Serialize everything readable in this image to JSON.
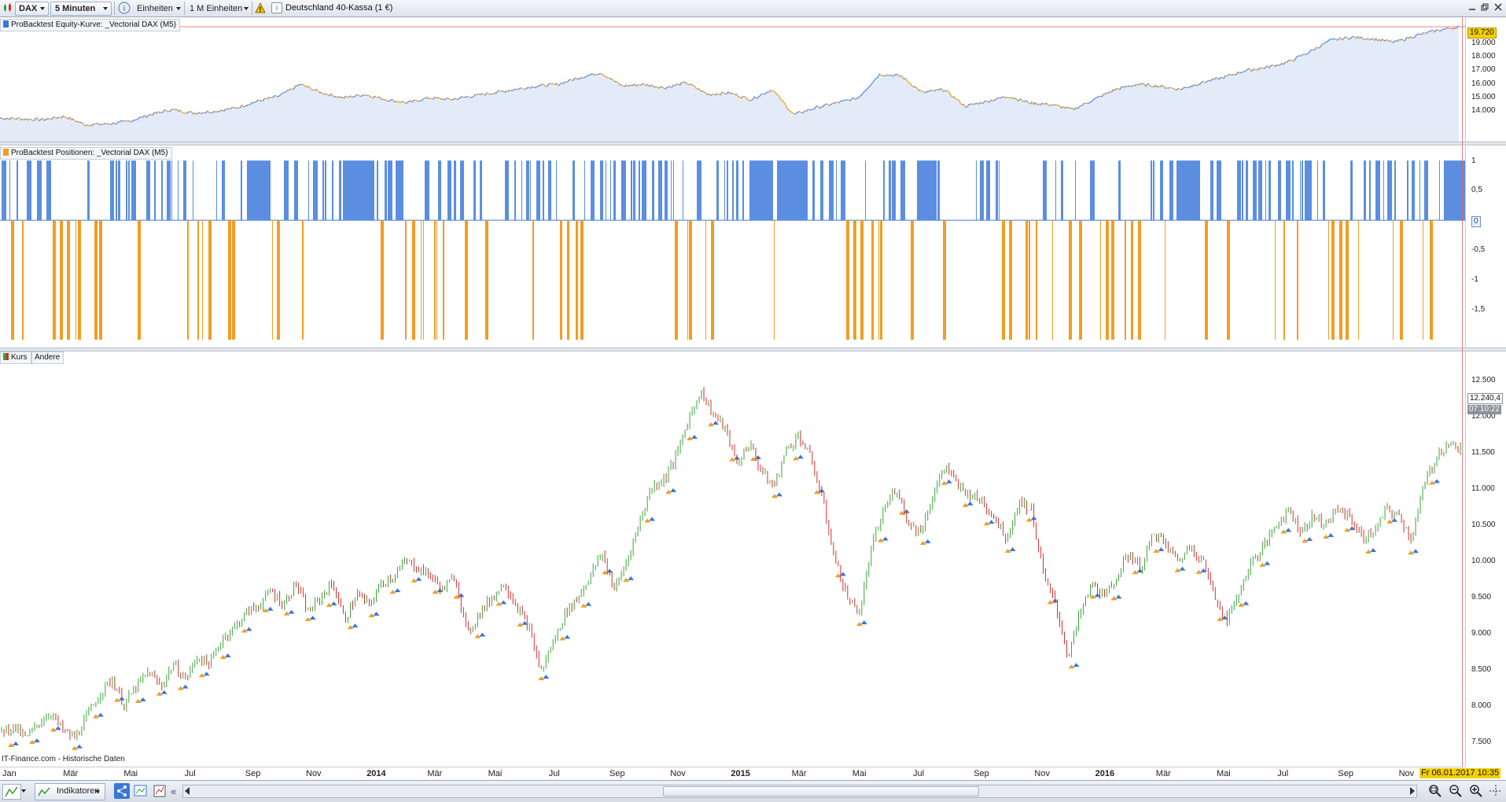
{
  "toolbar": {
    "instrument": "DAX",
    "timeframe": "5 Minuten",
    "units_label": "Einheiten",
    "units_amount": "1 M Einheiten",
    "instrument_name": "Deutschland 40-Kassa (1 €)"
  },
  "equity_panel": {
    "title": "ProBacktest Equity-Kurve: _Vectorial DAX (M5)",
    "last_value": "19.720",
    "ticks": [
      "19.000",
      "18.000",
      "17.000",
      "16.000",
      "15.000",
      "14.000"
    ]
  },
  "positions_panel": {
    "title": "ProBacktest Positionen: _Vectorial DAX (M5)",
    "zero_label": "0",
    "ticks": [
      "1",
      "0,5",
      "-0,5",
      "-1",
      "-1,5"
    ]
  },
  "price_panel": {
    "tab_kurs": "Kurs",
    "tab_andere": "Andere",
    "last_price": "12.240,4",
    "last_time": "07:10:22",
    "source_note": "IT-Finance.com - Historische Daten",
    "ticks": [
      "12.500",
      "12.000",
      "11.500",
      "11.000",
      "10.500",
      "10.000",
      "9.500",
      "9.000",
      "8.500",
      "8.000",
      "7.500"
    ]
  },
  "x_axis": {
    "labels": [
      {
        "text": "Jan",
        "year": false
      },
      {
        "text": "Mär",
        "year": false
      },
      {
        "text": "Mai",
        "year": false
      },
      {
        "text": "Jul",
        "year": false
      },
      {
        "text": "Sep",
        "year": false
      },
      {
        "text": "Nov",
        "year": false
      },
      {
        "text": "2014",
        "year": true
      },
      {
        "text": "Mär",
        "year": false
      },
      {
        "text": "Mai",
        "year": false
      },
      {
        "text": "Jul",
        "year": false
      },
      {
        "text": "Sep",
        "year": false
      },
      {
        "text": "Nov",
        "year": false
      },
      {
        "text": "2015",
        "year": true
      },
      {
        "text": "Mär",
        "year": false
      },
      {
        "text": "Mai",
        "year": false
      },
      {
        "text": "Jul",
        "year": false
      },
      {
        "text": "Sep",
        "year": false
      },
      {
        "text": "Nov",
        "year": false
      },
      {
        "text": "2016",
        "year": true
      },
      {
        "text": "Mär",
        "year": false
      },
      {
        "text": "Mai",
        "year": false
      },
      {
        "text": "Jul",
        "year": false
      },
      {
        "text": "Sep",
        "year": false
      },
      {
        "text": "Nov",
        "year": false
      }
    ],
    "current_date": "Fr 06.01.2017 10:35"
  },
  "bottombar": {
    "indicators_label": "Indikatoren"
  },
  "chart_data": [
    {
      "type": "area",
      "panel": "equity",
      "ylim": [
        13000,
        20000
      ],
      "series": [
        {
          "values": [
            14300,
            14250,
            14200,
            14400,
            13900,
            13950,
            14100,
            14500,
            14800,
            14600,
            14700,
            14900,
            15300,
            15600,
            16300,
            15800,
            15500,
            15700,
            15400,
            15200,
            15500,
            15400,
            15600,
            15800,
            16000,
            16200,
            16300,
            16700,
            17000,
            16200,
            16300,
            16100,
            16400,
            15700,
            15800,
            15400,
            16000,
            14500,
            14900,
            15200,
            15500,
            16900,
            16800,
            15800,
            16000,
            15000,
            15300,
            15600,
            15200,
            15100,
            14800,
            15400,
            16000,
            16300,
            16200,
            16000,
            16400,
            16700,
            17100,
            17300,
            17600,
            18200,
            18900,
            19100,
            19000,
            18800,
            19200,
            19500,
            19720
          ]
        }
      ]
    },
    {
      "type": "bar",
      "panel": "positions",
      "ylim": [
        -2,
        1.2
      ],
      "series": [
        {
          "name": "long",
          "values": [
            1
          ]
        },
        {
          "name": "short",
          "values": [
            -2
          ]
        }
      ]
    },
    {
      "type": "line",
      "panel": "price",
      "ylim": [
        7300,
        12600
      ],
      "series": [
        {
          "values": [
            7700,
            7750,
            7600,
            7800,
            7950,
            7700,
            7600,
            7900,
            8200,
            8400,
            8050,
            8300,
            8500,
            8300,
            8600,
            8400,
            8700,
            8600,
            8950,
            9100,
            9300,
            9400,
            9600,
            9400,
            9700,
            9300,
            9500,
            9700,
            9200,
            9550,
            9400,
            9700,
            9800,
            10000,
            9900,
            9800,
            9600,
            9800,
            9000,
            9300,
            9500,
            9700,
            9400,
            9100,
            8500,
            8900,
            9300,
            9500,
            9800,
            10100,
            9600,
            10000,
            10500,
            11000,
            11100,
            11400,
            11900,
            12300,
            12000,
            11800,
            11300,
            11600,
            11200,
            11000,
            11500,
            11700,
            11400,
            10800,
            10000,
            9500,
            9300,
            10200,
            10700,
            11000,
            10500,
            10400,
            10900,
            11300,
            11000,
            10900,
            10800,
            10600,
            10300,
            10800,
            10700,
            9800,
            9400,
            8700,
            9300,
            9700,
            9500,
            9800,
            10100,
            9900,
            10400,
            10200,
            10000,
            10200,
            10000,
            9500,
            9200,
            9600,
            10000,
            10200,
            10500,
            10700,
            10400,
            10600,
            10500,
            10700,
            10600,
            10300,
            10400,
            10700,
            10600,
            10300,
            11000,
            11400,
            11600,
            11500
          ]
        }
      ]
    }
  ]
}
